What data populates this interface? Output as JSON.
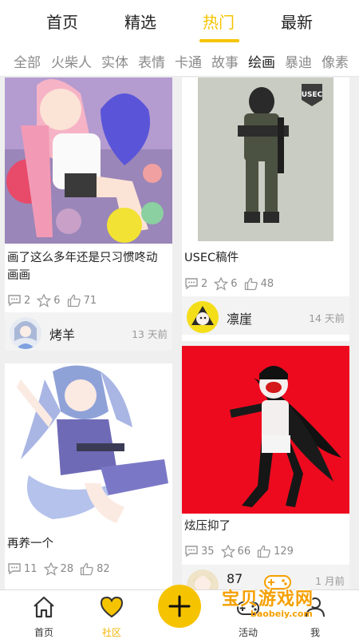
{
  "top_tabs": [
    {
      "label": "首页",
      "active": false
    },
    {
      "label": "精选",
      "active": false
    },
    {
      "label": "热门",
      "active": true
    },
    {
      "label": "最新",
      "active": false
    }
  ],
  "categories": [
    {
      "label": "全部",
      "active": false
    },
    {
      "label": "火柴人",
      "active": false
    },
    {
      "label": "实体",
      "active": false
    },
    {
      "label": "表情",
      "active": false
    },
    {
      "label": "卡通",
      "active": false
    },
    {
      "label": "故事",
      "active": false
    },
    {
      "label": "绘画",
      "active": true
    },
    {
      "label": "暴迪",
      "active": false
    },
    {
      "label": "像素",
      "active": false
    }
  ],
  "posts": [
    {
      "title_line1": "画了这么多年还是只习惯咚动",
      "title_line2": "画画",
      "comments": "2",
      "stars": "6",
      "likes": "71",
      "author": "烤羊",
      "time": "13 天前"
    },
    {
      "title_line1": "USEC稿件",
      "comments": "2",
      "stars": "6",
      "likes": "48",
      "author": "凛崖",
      "time": "14 天前",
      "art_text": "USEC"
    },
    {
      "title_line1": "再养一个",
      "comments": "11",
      "stars": "28",
      "likes": "82"
    },
    {
      "title_line1": "炫压抑了",
      "comments": "35",
      "stars": "66",
      "likes": "129",
      "author_partial": "87",
      "time": "1 月前"
    }
  ],
  "bottom_nav": [
    {
      "label": "首页",
      "icon": "home-icon",
      "active": false
    },
    {
      "label": "社区",
      "icon": "heart-icon",
      "active": true
    },
    {
      "label": "活动",
      "icon": "gamepad-icon",
      "active": false
    },
    {
      "label": "我",
      "icon": "person-icon",
      "active": false
    }
  ],
  "fab_icon": "plus-icon",
  "watermark": {
    "text": "宝贝游戏网",
    "url": "baobeiy.com"
  },
  "colors": {
    "accent": "#f5c400",
    "art_red": "#ee0a1e"
  }
}
